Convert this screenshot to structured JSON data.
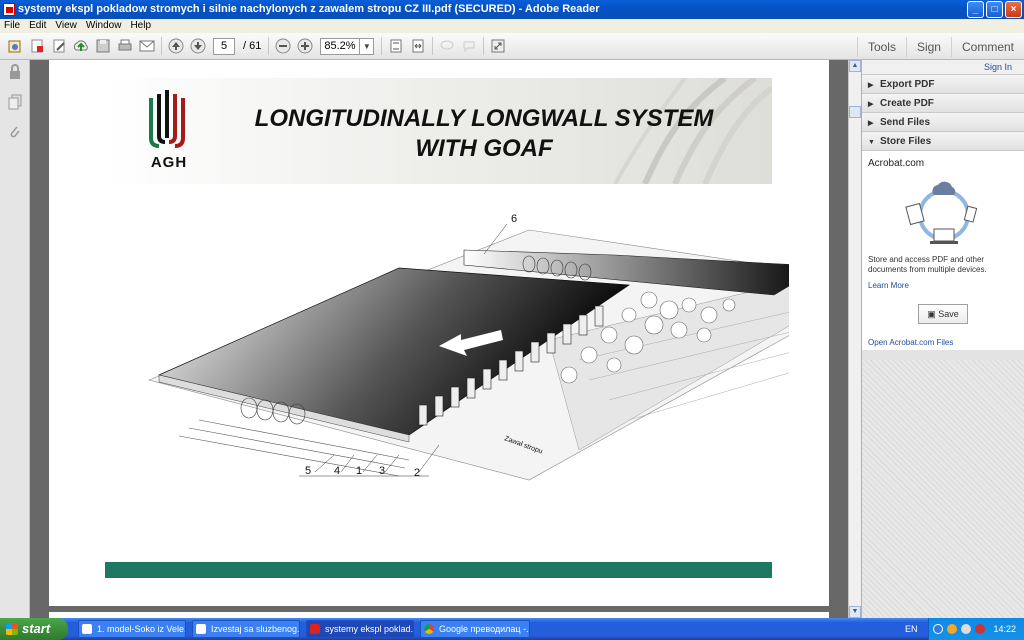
{
  "window": {
    "title": "systemy ekspl pokladow stromych i silnie nachylonych z zawalem stropu CZ III.pdf (SECURED) - Adobe Reader",
    "controls": [
      "_",
      "□",
      "×"
    ]
  },
  "menu": [
    "File",
    "Edit",
    "View",
    "Window",
    "Help"
  ],
  "toolbar": {
    "page_current": "5",
    "page_total": "/ 61",
    "zoom": "85.2%",
    "right_tabs": [
      "Tools",
      "Sign",
      "Comment"
    ]
  },
  "document": {
    "slide_title_line1": "LONGITUDINALLY LONGWALL SYSTEM",
    "slide_title_line2": "WITH GOAF",
    "logo_text": "AGH",
    "figure_labels": [
      "6",
      "5",
      "4",
      "1",
      "3",
      "2"
    ],
    "figure_annotation": "Zawał stropu"
  },
  "sidepanel": {
    "sign_in": "Sign In",
    "sections": [
      "Export PDF",
      "Create PDF",
      "Send Files",
      "Store Files"
    ],
    "store_heading": "Acrobat.com",
    "store_desc": "Store and access PDF and other documents from multiple devices.",
    "learn_more": "Learn More",
    "save_button": "Save",
    "open_link": "Open Acrobat.com Files"
  },
  "taskbar": {
    "start": "start",
    "tasks": [
      "1. model-Soko iz Vele...",
      "Izvestaj sa sluzbenog...",
      "systemy ekspl poklad...",
      "Google преводилац -..."
    ],
    "language": "EN",
    "clock": "14:22"
  },
  "colors": {
    "accent_green": "#1e7864",
    "title_blue": "#0453c4",
    "start_green": "#3c8f3c"
  }
}
